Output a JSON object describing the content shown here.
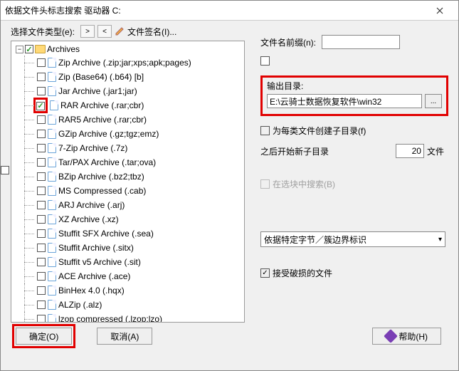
{
  "window": {
    "title": "依据文件头标志搜索 驱动器 C:"
  },
  "toolbar": {
    "label": "选择文件类型(e):",
    "prev": ">",
    "next": "<",
    "signature": "文件签名(I)..."
  },
  "tree": {
    "root": {
      "label": "Archives",
      "expanded": true,
      "checked": true
    },
    "items": [
      {
        "label": "Zip Archive (.zip;jar;xps;apk;pages)",
        "checked": false
      },
      {
        "label": "Zip (Base64) (.b64) [b]",
        "checked": false
      },
      {
        "label": "Jar Archive (.jar1;jar)",
        "checked": false
      },
      {
        "label": "RAR Archive (.rar;cbr)",
        "checked": true,
        "highlighted": true
      },
      {
        "label": "RAR5 Archive (.rar;cbr)",
        "checked": false
      },
      {
        "label": "GZip Archive (.gz;tgz;emz)",
        "checked": false
      },
      {
        "label": "7-Zip Archive (.7z)",
        "checked": false
      },
      {
        "label": "Tar/PAX Archive (.tar;ova)",
        "checked": false
      },
      {
        "label": "BZip Archive (.bz2;tbz)",
        "checked": false
      },
      {
        "label": "MS Compressed (.cab)",
        "checked": false
      },
      {
        "label": "ARJ Archive (.arj)",
        "checked": false
      },
      {
        "label": "XZ Archive (.xz)",
        "checked": false
      },
      {
        "label": "Stuffit SFX Archive (.sea)",
        "checked": false
      },
      {
        "label": "Stuffit Archive (.sitx)",
        "checked": false
      },
      {
        "label": "Stuffit v5 Archive (.sit)",
        "checked": false
      },
      {
        "label": "ACE Archive (.ace)",
        "checked": false
      },
      {
        "label": "BinHex 4.0 (.hqx)",
        "checked": false
      },
      {
        "label": "ALZip (.alz)",
        "checked": false
      },
      {
        "label": "lzop compressed (.lzop;lzo)",
        "checked": false
      }
    ]
  },
  "right": {
    "prefix_label": "文件名前缀(n):",
    "prefix_value": "",
    "output_label": "输出目录:",
    "output_value": "E:\\云骑士数据恢复软件\\win32",
    "subdir_check_label": "为每类文件创建子目录(f)",
    "subdir_after_label": "之后开始新子目录",
    "subdir_after_value": "20",
    "subdir_after_unit": "文件",
    "search_in_sel_label": "在选块中搜索(B)",
    "combo_value": "依据特定字节／簇边界标识",
    "accept_damaged_label": "接受破损的文件"
  },
  "buttons": {
    "ok": "确定(O)",
    "cancel": "取消(A)",
    "help": "帮助(H)"
  }
}
